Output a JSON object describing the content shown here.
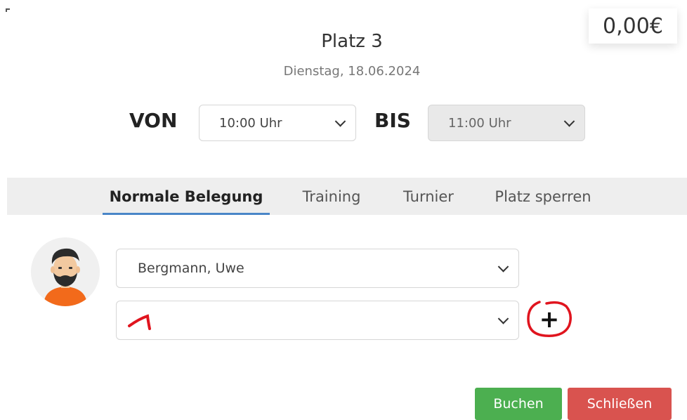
{
  "price": "0,00€",
  "court": {
    "title": "Platz 3",
    "date": "Dienstag, 18.06.2024"
  },
  "time": {
    "from_label": "VON",
    "from_value": "10:00 Uhr",
    "to_label": "BIS",
    "to_value": "11:00 Uhr"
  },
  "tabs": [
    {
      "label": "Normale Belegung",
      "active": true
    },
    {
      "label": "Training",
      "active": false
    },
    {
      "label": "Turnier",
      "active": false
    },
    {
      "label": "Platz sperren",
      "active": false
    }
  ],
  "players": {
    "player1": "Bergmann, Uwe",
    "player2": "",
    "add_label": "+"
  },
  "annotation": {
    "color": "#e0141e"
  },
  "buttons": {
    "book": "Buchen",
    "close": "Schließen"
  },
  "colors": {
    "book": "#4caf50",
    "close": "#d9534f",
    "active_tab": "#4a86c8"
  }
}
